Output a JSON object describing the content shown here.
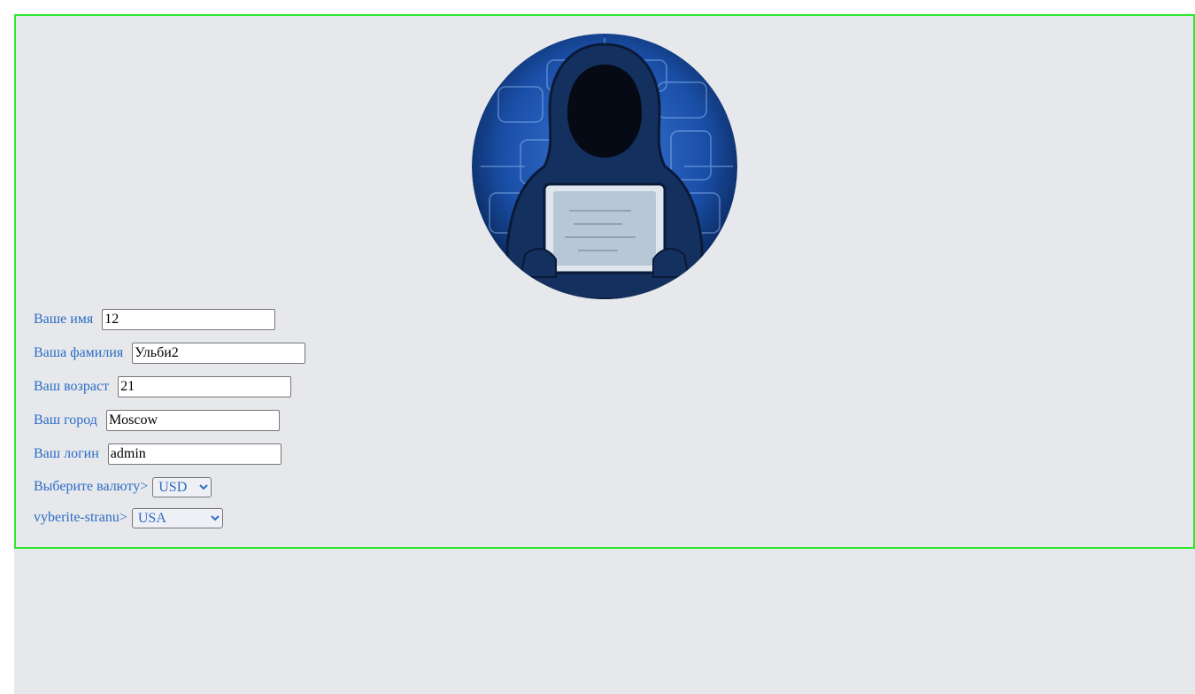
{
  "avatar": {
    "icon": "hooded-hacker-laptop",
    "colors": {
      "bg": "#1a4fa8",
      "rim": "#0b2a5e",
      "hood": "#14305e"
    }
  },
  "form": {
    "accent_color": "#2b6cc4",
    "border_color": "#2ee82e",
    "fields": [
      {
        "label": "Ваше имя",
        "value": "12"
      },
      {
        "label": "Ваша фамилия",
        "value": "Ульби2"
      },
      {
        "label": "Ваш возраст",
        "value": "21"
      },
      {
        "label": "Ваш город",
        "value": "Moscow"
      },
      {
        "label": "Ваш логин",
        "value": "admin"
      }
    ],
    "currency": {
      "label": "Выберите валюту>",
      "selected": "USD"
    },
    "country": {
      "label": "vyberite-stranu>",
      "selected": "USA"
    }
  }
}
